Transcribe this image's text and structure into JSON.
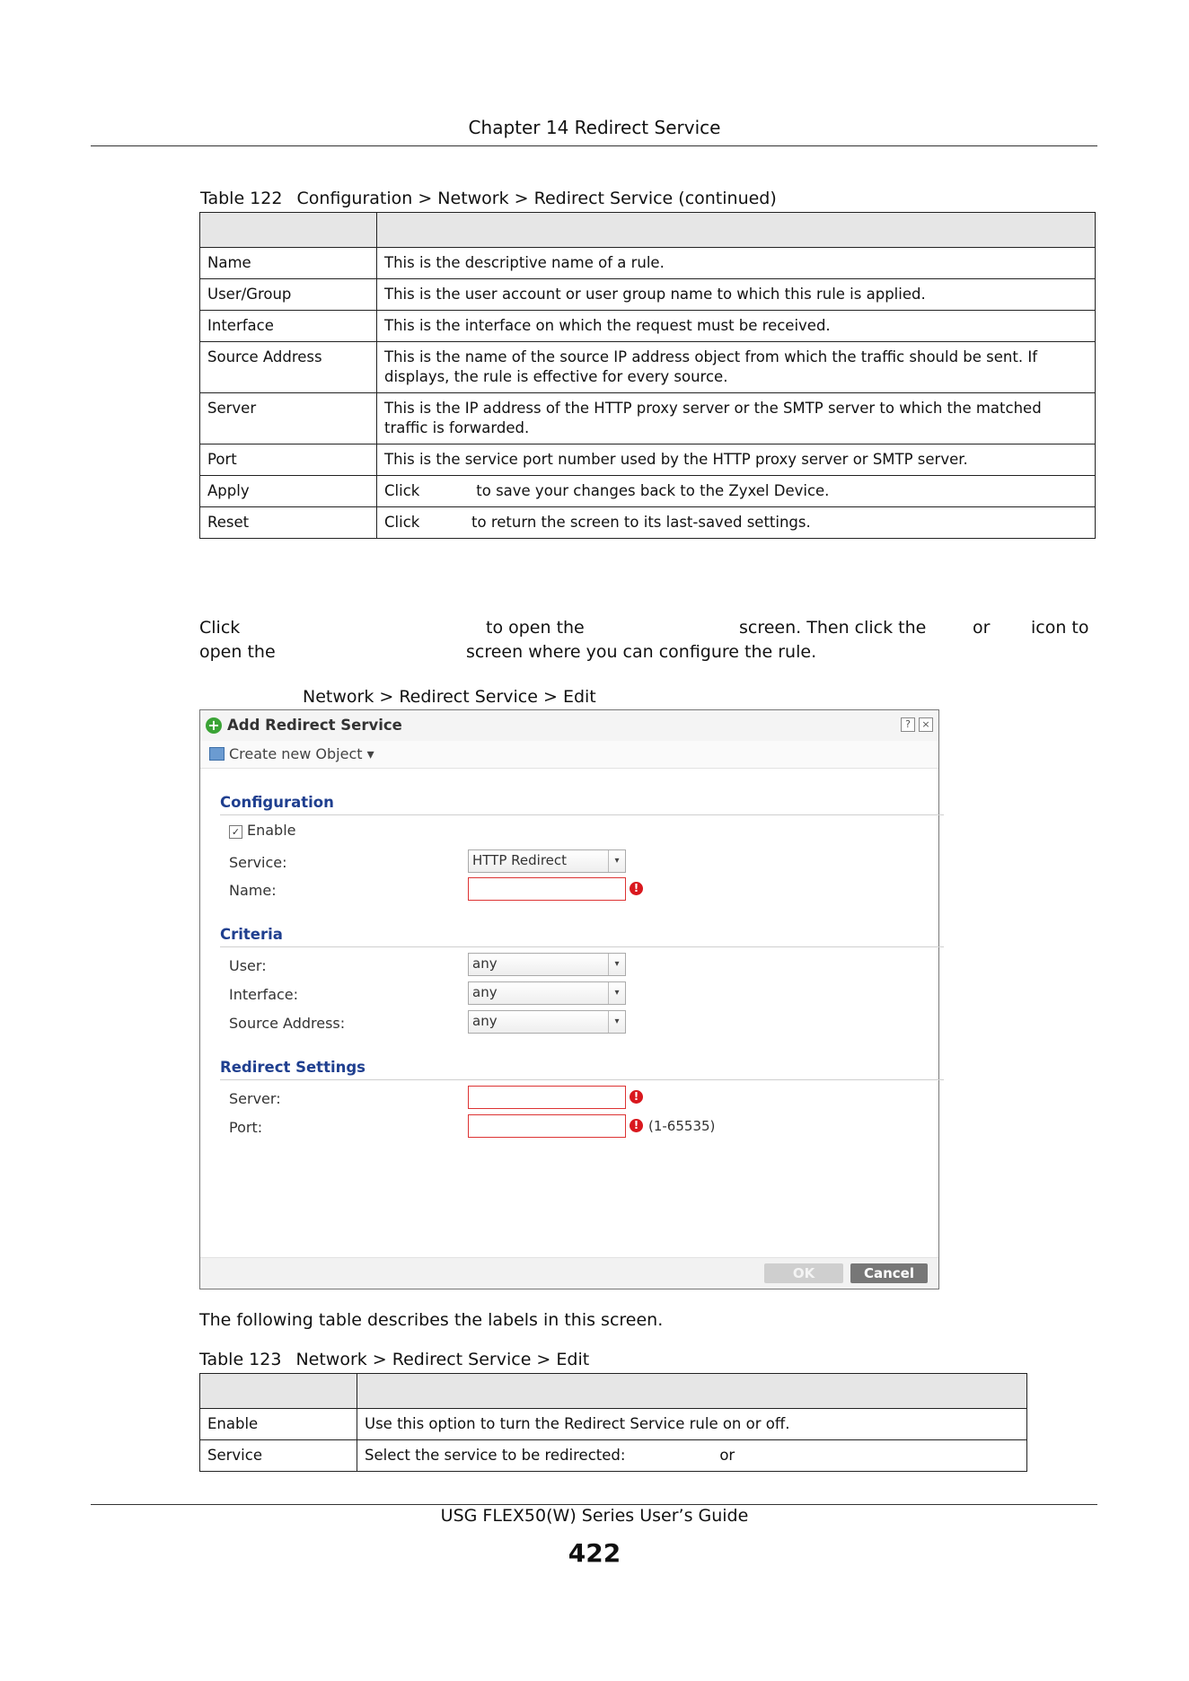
{
  "header": {
    "chapter": "Chapter 14 Redirect Service"
  },
  "table1": {
    "number": "Table 122",
    "title": "Configuration > Network > Redirect Service (continued)",
    "rows": [
      {
        "label": "Name",
        "desc": "This is the descriptive name of a rule."
      },
      {
        "label": "User/Group",
        "desc": "This is the user account or user group name to which this rule is applied."
      },
      {
        "label": "Interface",
        "desc": "This is the interface on which the request must be received."
      },
      {
        "label": "Source Address",
        "desc": "This is the name of the source IP address object from which the traffic should be sent. If displays, the rule is effective for every source."
      },
      {
        "label": "Server",
        "desc": "This is the IP address of the HTTP proxy server or the SMTP server to which the matched traffic is forwarded."
      },
      {
        "label": "Port",
        "desc": "This is the service port number used by the HTTP proxy server or SMTP server."
      },
      {
        "label": "Apply",
        "desc": "Click            to save your changes back to the Zyxel Device."
      },
      {
        "label": "Reset",
        "desc": "Click           to return the screen to its last-saved settings."
      }
    ]
  },
  "paragraph": {
    "line1": [
      "Click",
      "to open the",
      "screen. Then click the",
      "or",
      "icon to"
    ],
    "line2": [
      "open the",
      "screen where you can configure the rule."
    ]
  },
  "figure": {
    "caption": "Network > Redirect Service > Edit",
    "dialog_title": "Add Redirect Service",
    "help_glyph": "?",
    "close_glyph": "×",
    "toolbar_label": "Create new Object ▾",
    "sections": {
      "configuration": "Configuration",
      "criteria": "Criteria",
      "redirect": "Redirect Settings"
    },
    "enable_label": "Enable",
    "check_glyph": "✓",
    "labels": {
      "service": "Service:",
      "name": "Name:",
      "user": "User:",
      "interface": "Interface:",
      "source": "Source Address:",
      "server": "Server:",
      "port": "Port:"
    },
    "values": {
      "service": "HTTP Redirect",
      "user": "any",
      "interface": "any",
      "source": "any"
    },
    "port_hint": "(1-65535)",
    "error_glyph": "!",
    "arrow_glyph": "▾",
    "ok_label": "OK",
    "cancel_label": "Cancel"
  },
  "intro2": "The following table describes the labels in this screen.",
  "table2": {
    "number": "Table 123",
    "title": "Network > Redirect Service > Edit",
    "rows": [
      {
        "label": "Enable",
        "desc": "Use this option to turn the Redirect Service rule on or off."
      },
      {
        "label": "Service",
        "desc": "Select the service to be redirected:                    or"
      }
    ]
  },
  "footer": {
    "guide": "USG FLEX50(W) Series User’s Guide",
    "page": "422"
  }
}
